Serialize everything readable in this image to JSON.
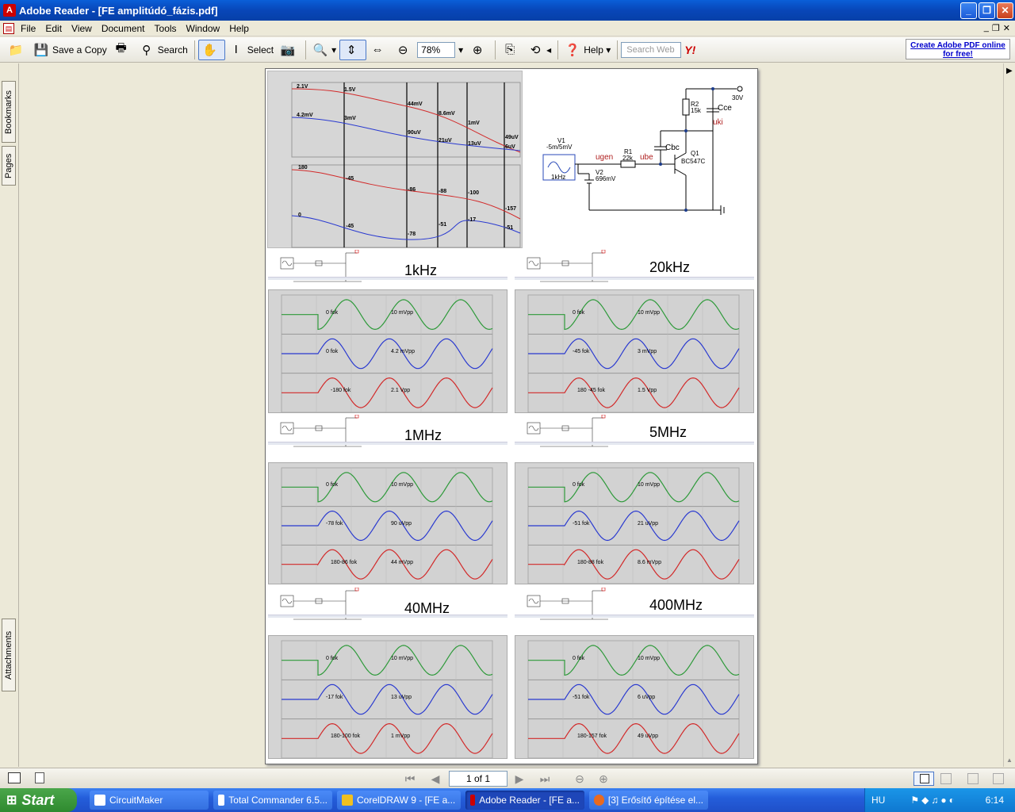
{
  "window": {
    "title": "Adobe Reader - [FE amplitúdó_fázis.pdf]"
  },
  "menu": [
    "File",
    "Edit",
    "View",
    "Document",
    "Tools",
    "Window",
    "Help"
  ],
  "toolbar": {
    "save_copy": "Save a Copy",
    "search": "Search",
    "select": "Select",
    "zoom": "78%",
    "help": "Help",
    "search_web_placeholder": "Search Web",
    "create_pdf": "Create Adobe PDF online for free!"
  },
  "sidepanel": {
    "bookmarks": "Bookmarks",
    "pages": "Pages",
    "attachments": "Attachments"
  },
  "document": {
    "bode": {
      "mag_labels": [
        "2.1V",
        "1.5V",
        "44mV",
        "8.6mV",
        "1mV",
        "49uV",
        "4.2mV",
        "3mV",
        "90uV",
        "21uV",
        "13uV",
        "6uV"
      ],
      "phase_labels": [
        "180",
        "-45",
        "-86",
        "-88",
        "-100",
        "-157",
        "0",
        "-45",
        "-78",
        "-51",
        "-17",
        "-51"
      ]
    },
    "schematic": {
      "supply": "30V",
      "r2": "R2",
      "r2_val": "15k",
      "cce": "Cce",
      "uki": "uki",
      "v1": "V1",
      "v1_val": "-5m/5mV",
      "v1_freq": "1kHz",
      "ugen": "ugen",
      "r1": "R1",
      "r1_val": "22k",
      "ube": "ube",
      "cbc": "Cbc",
      "q1": "Q1",
      "q1_val": "BC547C",
      "v2": "V2",
      "v2_val": "696mV"
    },
    "panels": [
      {
        "freq": "1kHz",
        "g": [
          "0 fok",
          "10 mVpp"
        ],
        "b": [
          "0 fok",
          "4.2 mVpp"
        ],
        "r": [
          "-180 fok",
          "2.1 Vpp"
        ]
      },
      {
        "freq": "20kHz",
        "g": [
          "0 fok",
          "10 mVpp"
        ],
        "b": [
          "-45 fok",
          "3 mVpp"
        ],
        "r": [
          "180 -45 fok",
          "1.5 Vpp"
        ]
      },
      {
        "freq": "1MHz",
        "g": [
          "0 fok",
          "10 mVpp"
        ],
        "b": [
          "-78 fok",
          "90 uVpp"
        ],
        "r": [
          "180-86 fok",
          "44 mVpp"
        ]
      },
      {
        "freq": "5MHz",
        "g": [
          "0 fok",
          "10 mVpp"
        ],
        "b": [
          "-51 fok",
          "21 uVpp"
        ],
        "r": [
          "180-88 fok",
          "8.6 mVpp"
        ]
      },
      {
        "freq": "40MHz",
        "g": [
          "0 fok",
          "10 mVpp"
        ],
        "b": [
          "-17 fok",
          "13 uVpp"
        ],
        "r": [
          "180-100 fok",
          "1 mVpp"
        ]
      },
      {
        "freq": "400MHz",
        "g": [
          "0 fok",
          "10 mVpp"
        ],
        "b": [
          "-51 fok",
          "6 uVpp"
        ],
        "r": [
          "180-157 fok",
          "49 uVpp"
        ]
      }
    ]
  },
  "status": {
    "page": "1 of 1"
  },
  "taskbar": {
    "start": "Start",
    "tasks": [
      "CircuitMaker",
      "Total Commander 6.5...",
      "CorelDRAW 9 - [FE a...",
      "Adobe Reader - [FE a...",
      "[3] Erősítő építése el..."
    ],
    "lang": "HU",
    "clock": "6:14"
  },
  "colors": {
    "green": "#2e9a3a",
    "blue": "#2a3ad0",
    "red": "#d22a2a"
  }
}
